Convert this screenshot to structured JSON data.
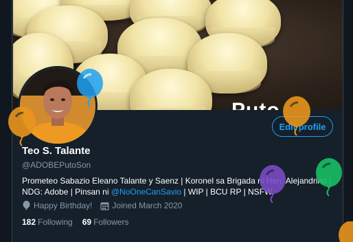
{
  "profile": {
    "name": "Teo S. Talante",
    "handle": "@ADOBEPutoSon",
    "edit_label": "Edit profile",
    "bio": {
      "part1": "Prometeo Sabazio Eleano Talante y Saenz | Koronel sa Brigada ni Hen. Alejandrino | NDG: Adobe | Pinsan ni ",
      "mention": "@NoOneCanSavio",
      "part2": " | WIP | BCU RP | NSFW"
    },
    "birthday": "Happy Birthday!",
    "joined": "Joined March 2020",
    "following_count": "182",
    "following_label": "Following",
    "followers_count": "69",
    "followers_label": "Followers"
  },
  "banner": {
    "text": "Puto"
  },
  "icons": {
    "birthday": "balloon-icon",
    "calendar": "calendar-icon"
  },
  "colors": {
    "background": "#15202b",
    "accent": "#1da1f2",
    "muted": "#8899a6",
    "balloon_orange": "#e8951c",
    "balloon_blue": "#1da1f2",
    "balloon_purple": "#794bc4",
    "balloon_green": "#17bf63"
  }
}
